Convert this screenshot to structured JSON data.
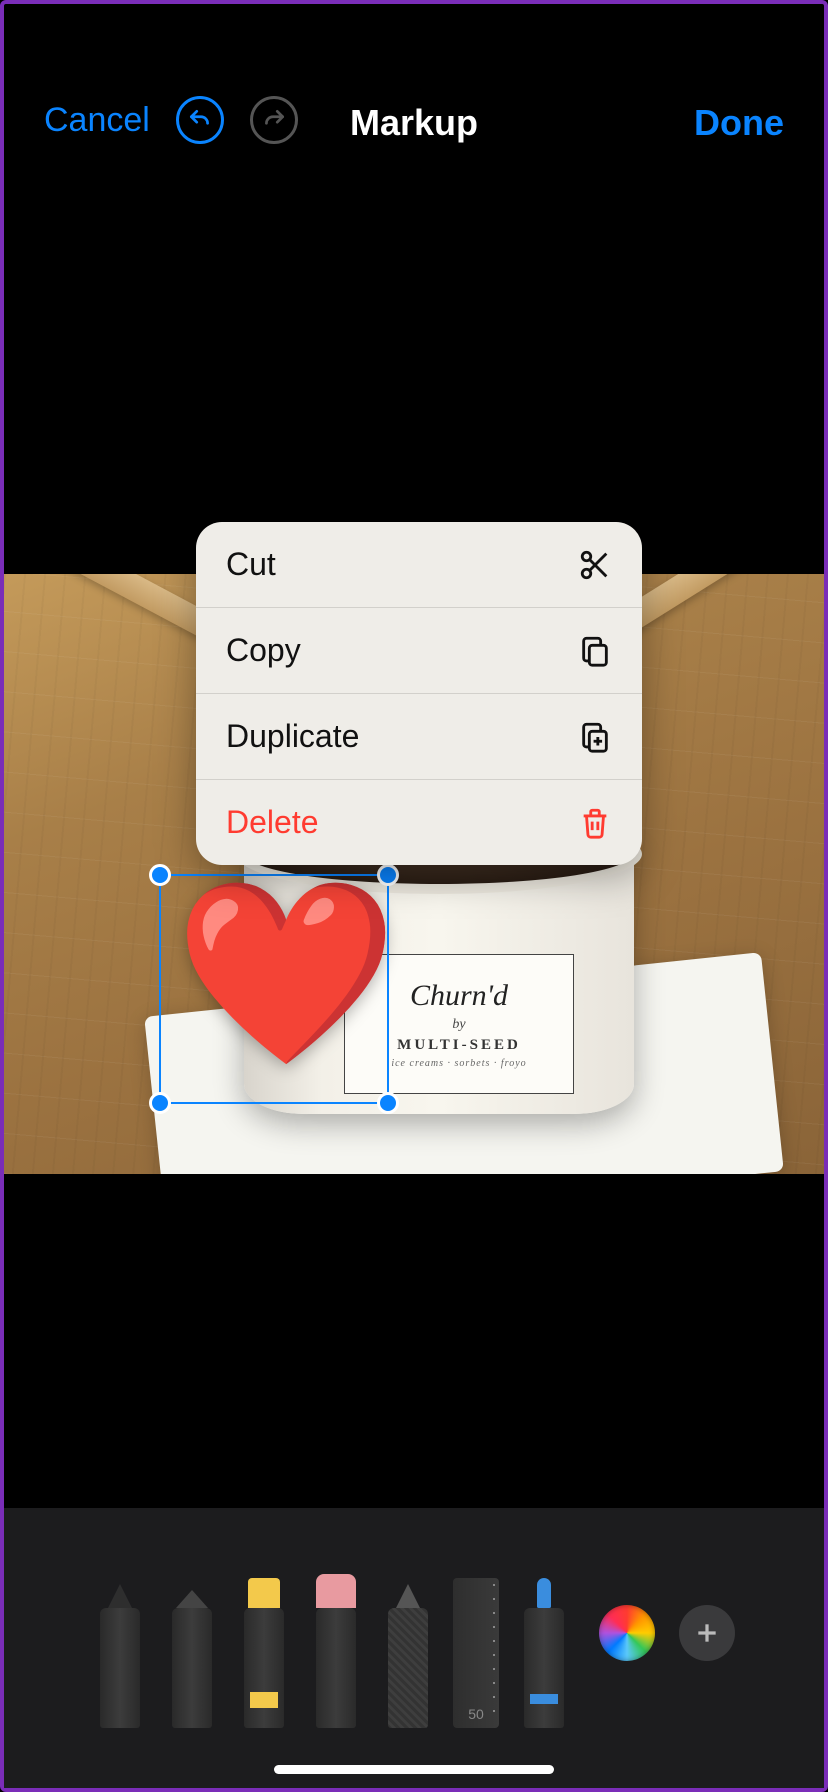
{
  "navbar": {
    "cancel": "Cancel",
    "title": "Markup",
    "done": "Done"
  },
  "context_menu": {
    "items": [
      {
        "label": "Cut",
        "icon": "scissors-icon",
        "destructive": false
      },
      {
        "label": "Copy",
        "icon": "copy-icon",
        "destructive": false
      },
      {
        "label": "Duplicate",
        "icon": "duplicate-icon",
        "destructive": false
      },
      {
        "label": "Delete",
        "icon": "trash-icon",
        "destructive": true
      }
    ]
  },
  "selected_object": {
    "type": "emoji-sticker",
    "glyph": "❤️"
  },
  "cup_label": {
    "brand": "Churn'd",
    "by": "by",
    "sub": "MULTI-SEED",
    "tagline": "ice creams · sorbets · froyo"
  },
  "toolbar": {
    "tools": [
      {
        "name": "pen-tool"
      },
      {
        "name": "marker-tool"
      },
      {
        "name": "highlighter-tool"
      },
      {
        "name": "eraser-tool"
      },
      {
        "name": "pencil-tool"
      },
      {
        "name": "ruler-tool",
        "value": "50"
      },
      {
        "name": "brush-tool"
      }
    ],
    "color_well": "rainbow",
    "add_button": "+"
  },
  "colors": {
    "accent": "#0a84ff",
    "destructive": "#ff3b30"
  }
}
